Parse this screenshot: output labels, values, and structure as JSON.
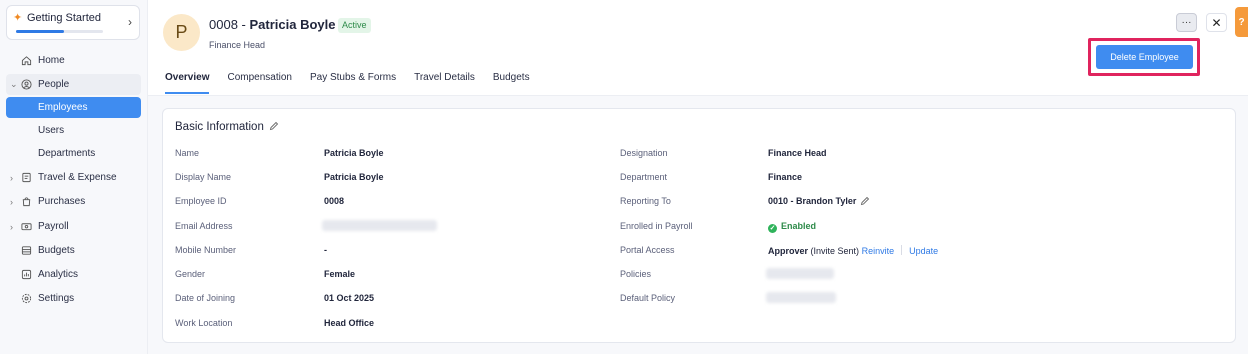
{
  "sidebar": {
    "getting_started": {
      "label": "Getting Started",
      "progress": 0.55
    },
    "items": [
      {
        "label": "Home",
        "icon": "home-icon"
      },
      {
        "label": "People",
        "icon": "person-icon"
      },
      {
        "label": "Employees"
      },
      {
        "label": "Users"
      },
      {
        "label": "Departments"
      },
      {
        "label": "Travel & Expense",
        "icon": "receipt-icon"
      },
      {
        "label": "Purchases",
        "icon": "bag-icon"
      },
      {
        "label": "Payroll",
        "icon": "cash-icon"
      },
      {
        "label": "Budgets",
        "icon": "budget-icon"
      },
      {
        "label": "Analytics",
        "icon": "analytics-icon"
      },
      {
        "label": "Settings",
        "icon": "gear-icon"
      }
    ]
  },
  "header": {
    "avatar_initial": "P",
    "employee_id": "0008",
    "dash": " - ",
    "employee_name": "Patricia Boyle",
    "status": "Active",
    "subtitle": "Finance Head",
    "more_label": "···",
    "close_label": "✕",
    "help_label": "?",
    "delete_label": "Delete Employee"
  },
  "tabs": [
    "Overview",
    "Compensation",
    "Pay Stubs & Forms",
    "Travel Details",
    "Budgets"
  ],
  "basic_info": {
    "title": "Basic Information",
    "left": [
      {
        "label": "Name",
        "value": "Patricia Boyle"
      },
      {
        "label": "Display Name",
        "value": "Patricia Boyle"
      },
      {
        "label": "Employee ID",
        "value": "0008"
      },
      {
        "label": "Email Address",
        "value": ""
      },
      {
        "label": "Mobile Number",
        "value": "-"
      },
      {
        "label": "Gender",
        "value": "Female"
      },
      {
        "label": "Date of Joining",
        "value": "01 Oct 2025"
      },
      {
        "label": "Work Location",
        "value": "Head Office"
      }
    ],
    "right": [
      {
        "label": "Designation",
        "value": "Finance Head"
      },
      {
        "label": "Department",
        "value": "Finance"
      },
      {
        "label": "Reporting To",
        "value": "0010 - Brandon Tyler"
      },
      {
        "label": "Enrolled in Payroll",
        "value": "Enabled"
      },
      {
        "label": "Portal Access",
        "value": "Approver",
        "value_extra": "(Invite Sent)",
        "link1": "Reinvite",
        "link2": "Update"
      },
      {
        "label": "Policies",
        "value": ""
      },
      {
        "label": "Default Policy",
        "value": ""
      }
    ]
  },
  "colors": {
    "accent": "#3f8cf0",
    "highlight": "#e0245e",
    "status_green": "#2fb35b"
  }
}
